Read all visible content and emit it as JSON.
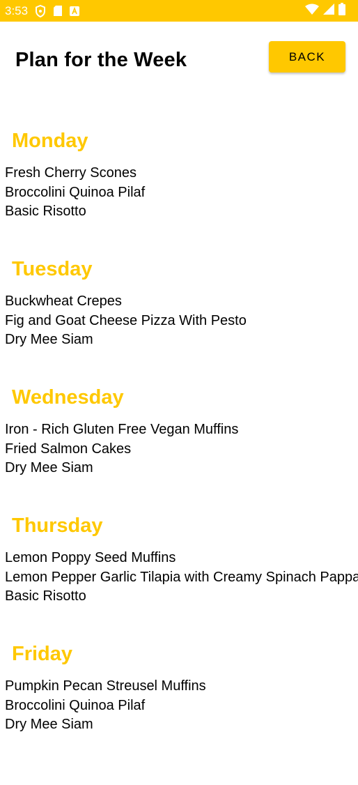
{
  "status_bar": {
    "time": "3:53",
    "icons": [
      "shield-icon",
      "sd-card-icon",
      "a-box-icon",
      "wifi-icon",
      "signal-icon",
      "battery-icon"
    ]
  },
  "header": {
    "title": "Plan for the Week",
    "back_label": "BACK"
  },
  "days": [
    {
      "name": "Monday",
      "meals": [
        "Fresh Cherry Scones",
        "Broccolini Quinoa Pilaf",
        "Basic Risotto"
      ]
    },
    {
      "name": "Tuesday",
      "meals": [
        "Buckwheat Crepes",
        "Fig and Goat Cheese Pizza With Pesto",
        "Dry Mee Siam"
      ]
    },
    {
      "name": "Wednesday",
      "meals": [
        "Iron - Rich Gluten Free Vegan Muffins",
        "Fried Salmon Cakes",
        "Dry Mee Siam"
      ]
    },
    {
      "name": "Thursday",
      "meals": [
        "Lemon Poppy Seed Muffins",
        "Lemon Pepper Garlic Tilapia with Creamy Spinach Pappa",
        "Basic Risotto"
      ]
    },
    {
      "name": "Friday",
      "meals": [
        "Pumpkin Pecan Streusel Muffins",
        "Broccolini Quinoa Pilaf",
        "Dry Mee Siam"
      ]
    }
  ],
  "colors": {
    "accent": "#FFC800",
    "text": "#000000",
    "background": "#FFFFFF"
  }
}
